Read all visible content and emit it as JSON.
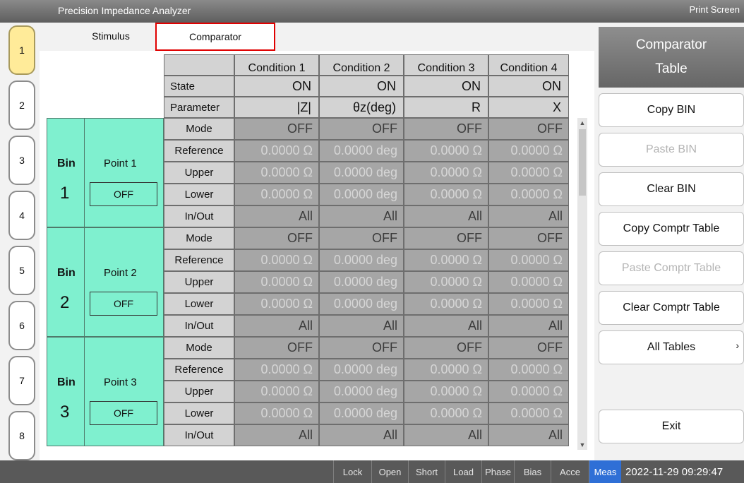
{
  "app": {
    "title": "Precision Impedance Analyzer",
    "print_screen": "Print Screen"
  },
  "channel_tabs": [
    "1",
    "2",
    "3",
    "4",
    "5",
    "6",
    "7",
    "8"
  ],
  "tabs": {
    "stimulus": "Stimulus",
    "comparator": "Comparator"
  },
  "table": {
    "conditions": [
      "Condition 1",
      "Condition 2",
      "Condition 3",
      "Condition 4"
    ],
    "state_label": "State",
    "states": [
      "ON",
      "ON",
      "ON",
      "ON"
    ],
    "parameter_label": "Parameter",
    "parameters": [
      "|Z|",
      "θz(deg)",
      "R",
      "X"
    ],
    "row_labels": [
      "Mode",
      "Reference",
      "Upper",
      "Lower",
      "In/Out"
    ],
    "bins": [
      {
        "bin_label": "Bin",
        "number": "1",
        "point": "Point 1",
        "button": "OFF",
        "rows": [
          [
            "OFF",
            "OFF",
            "OFF",
            "OFF"
          ],
          [
            "0.0000 Ω",
            "0.0000 deg",
            "0.0000 Ω",
            "0.0000 Ω"
          ],
          [
            "0.0000 Ω",
            "0.0000 deg",
            "0.0000 Ω",
            "0.0000 Ω"
          ],
          [
            "0.0000 Ω",
            "0.0000 deg",
            "0.0000 Ω",
            "0.0000 Ω"
          ],
          [
            "All",
            "All",
            "All",
            "All"
          ]
        ]
      },
      {
        "bin_label": "Bin",
        "number": "2",
        "point": "Point 2",
        "button": "OFF",
        "rows": [
          [
            "OFF",
            "OFF",
            "OFF",
            "OFF"
          ],
          [
            "0.0000 Ω",
            "0.0000 deg",
            "0.0000 Ω",
            "0.0000 Ω"
          ],
          [
            "0.0000 Ω",
            "0.0000 deg",
            "0.0000 Ω",
            "0.0000 Ω"
          ],
          [
            "0.0000 Ω",
            "0.0000 deg",
            "0.0000 Ω",
            "0.0000 Ω"
          ],
          [
            "All",
            "All",
            "All",
            "All"
          ]
        ]
      },
      {
        "bin_label": "Bin",
        "number": "3",
        "point": "Point 3",
        "button": "OFF",
        "rows": [
          [
            "OFF",
            "OFF",
            "OFF",
            "OFF"
          ],
          [
            "0.0000 Ω",
            "0.0000 deg",
            "0.0000 Ω",
            "0.0000 Ω"
          ],
          [
            "0.0000 Ω",
            "0.0000 deg",
            "0.0000 Ω",
            "0.0000 Ω"
          ],
          [
            "0.0000 Ω",
            "0.0000 deg",
            "0.0000 Ω",
            "0.0000 Ω"
          ],
          [
            "All",
            "All",
            "All",
            "All"
          ]
        ]
      }
    ]
  },
  "right_panel": {
    "title_line1": "Comparator",
    "title_line2": "Table",
    "buttons": [
      {
        "label": "Copy BIN",
        "enabled": true
      },
      {
        "label": "Paste BIN",
        "enabled": false
      },
      {
        "label": "Clear BIN",
        "enabled": true
      },
      {
        "label": "Copy Comptr Table",
        "enabled": true
      },
      {
        "label": "Paste Comptr Table",
        "enabled": false
      },
      {
        "label": "Clear Comptr Table",
        "enabled": true
      },
      {
        "label": "All Tables",
        "enabled": true,
        "submenu": "›"
      }
    ],
    "exit": "Exit"
  },
  "status": {
    "items": [
      "Lock",
      "Open",
      "Short",
      "Load",
      "Phase",
      "Bias",
      "Acce",
      "Meas"
    ],
    "active": "Meas",
    "datetime": "2022-11-29 09:29:47"
  },
  "colors": {
    "bin_green": "#7ff0cf",
    "selected_tab_border": "#e00000",
    "meas_blue": "#2f6fd6",
    "active_channel": "#ffeb99"
  }
}
